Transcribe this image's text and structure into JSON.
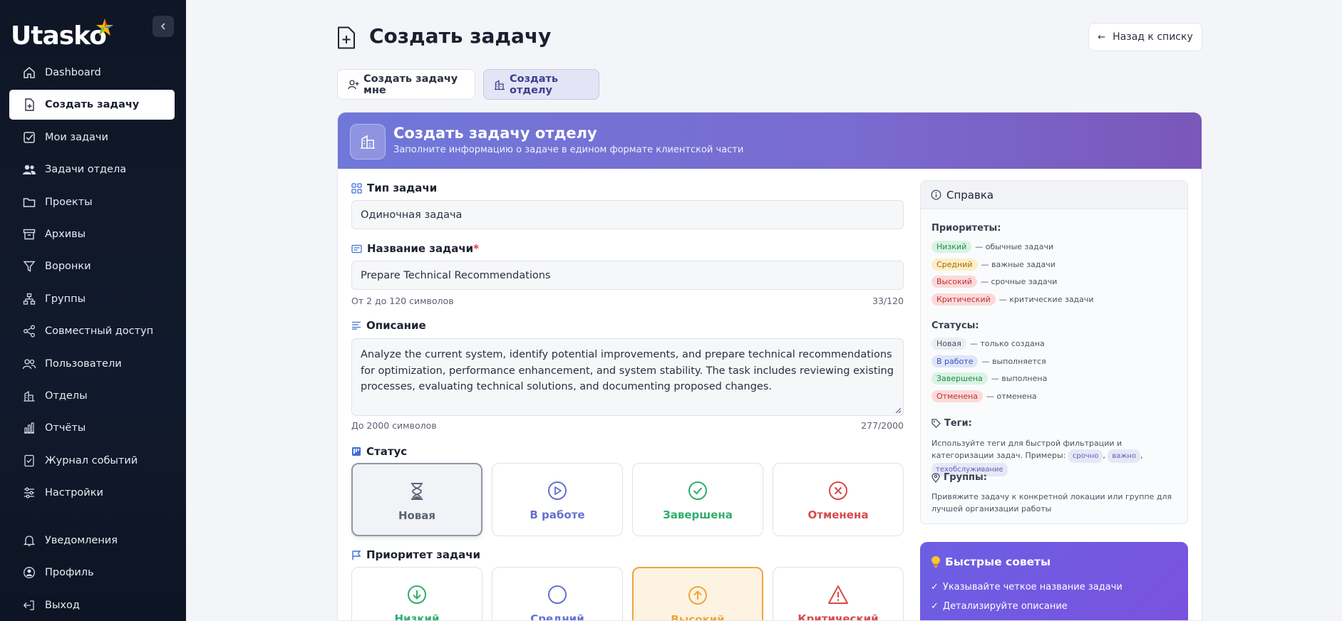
{
  "brand": {
    "name": "Utasko"
  },
  "sidebar": {
    "items": [
      {
        "label": "Dashboard",
        "icon": "home-icon"
      },
      {
        "label": "Создать задачу",
        "icon": "file-plus-icon",
        "active": true
      },
      {
        "label": "Мои задачи",
        "icon": "checkbox-icon"
      },
      {
        "label": "Задачи отдела",
        "icon": "users-icon"
      },
      {
        "label": "Проекты",
        "icon": "folder-icon"
      },
      {
        "label": "Архивы",
        "icon": "archive-icon"
      },
      {
        "label": "Воронки",
        "icon": "funnel-icon"
      },
      {
        "label": "Группы",
        "icon": "groups-icon"
      },
      {
        "label": "Совместный доступ",
        "icon": "share-icon"
      },
      {
        "label": "Пользователи",
        "icon": "user-group-icon"
      },
      {
        "label": "Отделы",
        "icon": "building-icon"
      },
      {
        "label": "Отчёты",
        "icon": "bar-chart-icon"
      },
      {
        "label": "Журнал событий",
        "icon": "journal-icon"
      },
      {
        "label": "Настройки",
        "icon": "sliders-icon"
      }
    ],
    "bottom": [
      {
        "label": "Уведомления",
        "icon": "bell-icon"
      },
      {
        "label": "Профиль",
        "icon": "profile-icon"
      },
      {
        "label": "Выход",
        "icon": "logout-icon"
      }
    ]
  },
  "header": {
    "title": "Создать задачу",
    "back_label": "Назад к списку"
  },
  "tabs": [
    {
      "label": "Создать задачу мне"
    },
    {
      "label": "Создать отделу",
      "active": true
    }
  ],
  "form": {
    "title": "Создать задачу отделу",
    "subtitle": "Заполните информацию о задаче в едином формате клиентской части",
    "type_label": "Тип задачи",
    "type_value": "Одиночная задача",
    "name_label": "Название задачи",
    "name_required": "*",
    "name_value": "Prepare Technical Recommendations",
    "name_hint": "От 2 до 120 символов",
    "name_count": "33/120",
    "desc_label": "Описание",
    "desc_value": "Analyze the current system, identify potential improvements, and prepare technical recommendations for optimization, performance enhancement, and system stability. The task includes reviewing existing processes, evaluating technical solutions, and documenting proposed changes.",
    "desc_hint": "До 2000 символов",
    "desc_count": "277/2000",
    "status_label": "Статус",
    "statuses": [
      {
        "label": "Новая",
        "color": "#5b6274",
        "selected": true
      },
      {
        "label": "В работе",
        "color": "#6470d0"
      },
      {
        "label": "Завершена",
        "color": "#2fae6e"
      },
      {
        "label": "Отменена",
        "color": "#d94a4a"
      }
    ],
    "priority_label": "Приоритет задачи",
    "priorities": [
      {
        "label": "Низкий",
        "color": "#2fae6e"
      },
      {
        "label": "Средний",
        "color": "#6470d0"
      },
      {
        "label": "Высокий",
        "color": "#f0a43a",
        "selected": true
      },
      {
        "label": "Критический",
        "color": "#d94a4a"
      }
    ]
  },
  "help": {
    "title": "Справка",
    "priorities_title": "Приоритеты:",
    "priorities": [
      {
        "badge": "Низкий",
        "text": "— обычные задачи"
      },
      {
        "badge": "Средний",
        "text": "— важные задачи"
      },
      {
        "badge": "Высокий",
        "text": "— срочные задачи"
      },
      {
        "badge": "Критический",
        "text": "— критические задачи"
      }
    ],
    "statuses_title": "Статусы:",
    "statuses": [
      {
        "badge": "Новая",
        "text": "— только создана"
      },
      {
        "badge": "В работе",
        "text": "— выполняется"
      },
      {
        "badge": "Завершена",
        "text": "— выполнена"
      },
      {
        "badge": "Отменена",
        "text": "— отменена"
      }
    ],
    "tags_title": "Теги:",
    "tags_text": "Используйте теги для быстрой фильтрации и категоризации задач. Примеры:",
    "tags": [
      "срочно",
      "важно",
      "техобслуживание"
    ],
    "groups_title": "Группы:",
    "groups_text": "Привяжите задачу к конкретной локации или группе для лучшей организации работы"
  },
  "tips": {
    "title": "Быстрые советы",
    "items": [
      "Указывайте четкое название задачи",
      "Детализируйте описание"
    ]
  }
}
